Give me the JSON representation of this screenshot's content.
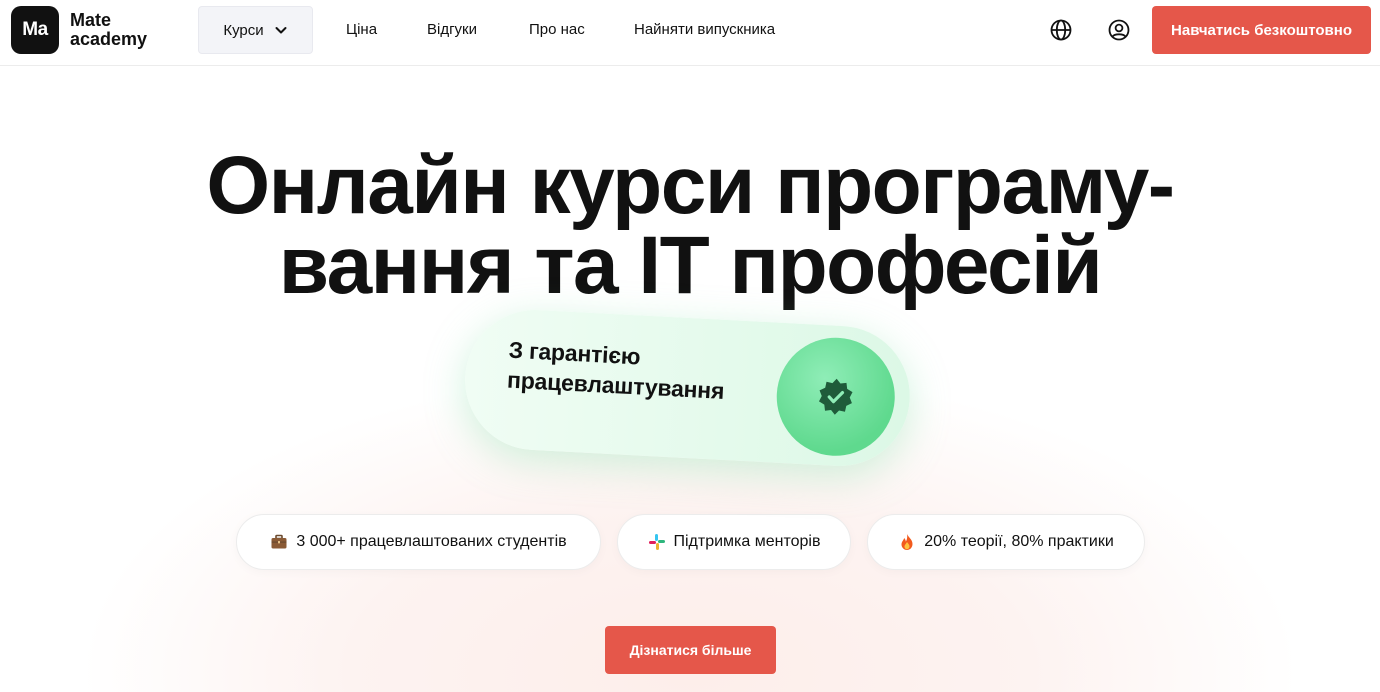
{
  "header": {
    "logo": {
      "mark": "Ma",
      "line1": "Mate",
      "line2": "academy"
    },
    "nav": {
      "courses": "Курси",
      "price": "Ціна",
      "reviews": "Відгуки",
      "about": "Про нас",
      "hire": "Найняти випускника"
    },
    "icons": {
      "language": "globe-icon",
      "account": "user-icon",
      "dropdown": "chevron-down-icon"
    },
    "cta": "Навчатись безкоштовно"
  },
  "hero": {
    "title_line1": "Онлайн курси програму-",
    "title_line2": "вання та IT професій",
    "badge": {
      "line1": "З гарантією",
      "line2": "працевлаштування",
      "icon": "verified-check-icon"
    },
    "features": [
      {
        "icon": "briefcase-icon",
        "text": "3 000+ працевлаштованих студентів"
      },
      {
        "icon": "slack-icon",
        "text": "Підтримка менторів"
      },
      {
        "icon": "fire-icon",
        "text": "20% теорії, 80% практики"
      }
    ],
    "cta": "Дізнатися більше"
  },
  "colors": {
    "accent": "#e5574a",
    "badge_green": "#5fd98e",
    "badge_check": "#1f5b3a",
    "text": "#111111"
  }
}
